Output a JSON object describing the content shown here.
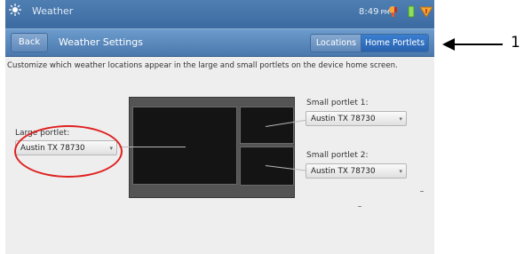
{
  "status_bar": {
    "app_name": "Weather",
    "time": "8:49",
    "time_suffix": "PM",
    "icons": [
      "weather-app-icon",
      "battery-warning-icon",
      "signal-icon",
      "alert-icon"
    ]
  },
  "title_bar": {
    "back_label": "Back",
    "title": "Weather Settings",
    "tabs": [
      {
        "label": "Locations",
        "selected": false
      },
      {
        "label": "Home Portlets",
        "selected": true
      }
    ]
  },
  "instructions": "Customize which weather locations appear in the large and small portlets on the device home screen.",
  "large_portlet": {
    "label": "Large portlet:",
    "value": "Austin TX 78730"
  },
  "small_portlet_1": {
    "label": "Small portlet 1:",
    "value": "Austin TX 78730"
  },
  "small_portlet_2": {
    "label": "Small portlet 2:",
    "value": "Austin TX 78730"
  },
  "annotation": {
    "callout_number": "1",
    "highlight_color": "#e02020"
  },
  "colors": {
    "titlebar": "#4a78ad",
    "selected_tab": "#2a63b0"
  }
}
